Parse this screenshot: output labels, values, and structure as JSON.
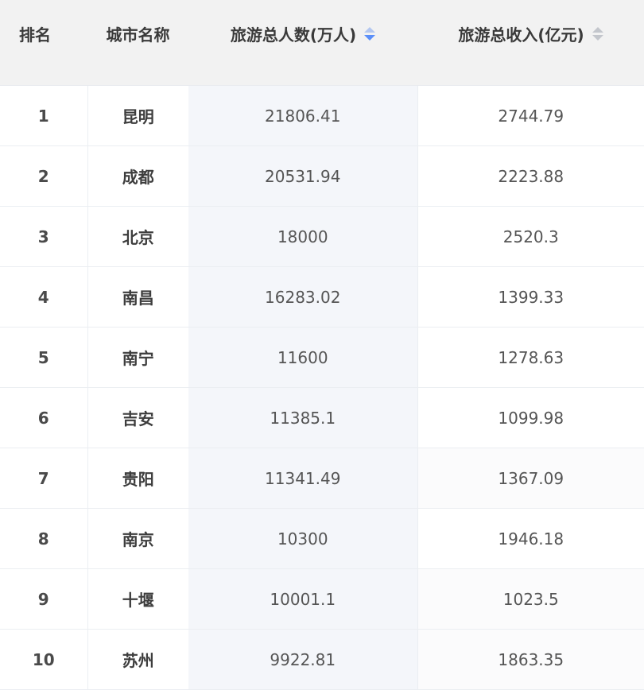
{
  "table": {
    "headers": {
      "rank": "排名",
      "city": "城市名称",
      "visitors": "旅游总人数(万人)",
      "income": "旅游总收入(亿元)"
    },
    "sort": {
      "visitors": "descending",
      "income": "none"
    },
    "colors": {
      "sort_active": "#5b8ff9",
      "sort_inactive": "#c3c6cc",
      "header_bg": "#f2f2f2",
      "sorted_column_bg": "#f4f6fa"
    },
    "rows": [
      {
        "rank": "1",
        "city": "昆明",
        "visitors": "21806.41",
        "income": "2744.79"
      },
      {
        "rank": "2",
        "city": "成都",
        "visitors": "20531.94",
        "income": "2223.88"
      },
      {
        "rank": "3",
        "city": "北京",
        "visitors": "18000",
        "income": "2520.3"
      },
      {
        "rank": "4",
        "city": "南昌",
        "visitors": "16283.02",
        "income": "1399.33"
      },
      {
        "rank": "5",
        "city": "南宁",
        "visitors": "11600",
        "income": "1278.63"
      },
      {
        "rank": "6",
        "city": "吉安",
        "visitors": "11385.1",
        "income": "1099.98"
      },
      {
        "rank": "7",
        "city": "贵阳",
        "visitors": "11341.49",
        "income": "1367.09"
      },
      {
        "rank": "8",
        "city": "南京",
        "visitors": "10300",
        "income": "1946.18"
      },
      {
        "rank": "9",
        "city": "十堰",
        "visitors": "10001.1",
        "income": "1023.5"
      },
      {
        "rank": "10",
        "city": "苏州",
        "visitors": "9922.81",
        "income": "1863.35"
      }
    ]
  }
}
